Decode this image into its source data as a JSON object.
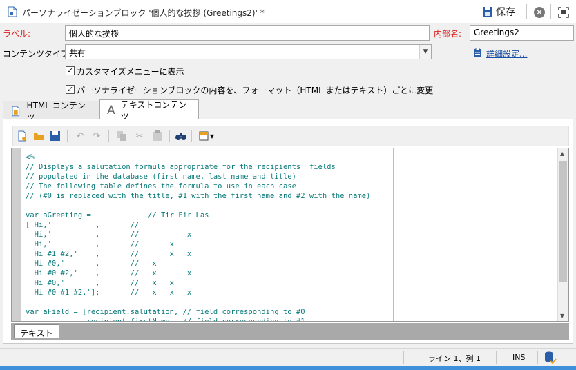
{
  "window": {
    "title": "パーソナライゼーションブロック '個人的な挨拶 (Greetings2)' *",
    "save_label": "保存"
  },
  "form": {
    "label_caption": "ラベル:",
    "label_value": "個人的な挨拶",
    "internal_name_caption": "内部名:",
    "internal_name_value": "Greetings2",
    "content_type_caption": "コンテンツタイプ:",
    "content_type_value": "共有",
    "advanced_settings_link": "詳細設定...",
    "checkbox_customize_menu": "カスタマイズメニューに表示",
    "checkbox_format_change": "パーソナライゼーションブロックの内容を、フォーマット（HTML またはテキスト）ごとに変更"
  },
  "tabs": [
    {
      "label": "HTML コンテンツ",
      "active": false
    },
    {
      "label": "テキストコンテンツ",
      "active": true
    }
  ],
  "tab_icons": {
    "html": "html-doc-icon",
    "text": "A"
  },
  "toolbar_icons": [
    "new-icon",
    "open-folder-icon",
    "save-disk-icon",
    "undo-icon",
    "redo-icon",
    "copy-icon",
    "cut-icon",
    "paste-icon",
    "find-binoculars-icon",
    "insert-menu-icon"
  ],
  "editor": {
    "code": "<%\n// Displays a salutation formula appropriate for the recipients' fields\n// populated in the database (first name, last name and title)\n// The following table defines the formula to use in each case\n// (#0 is replaced with the title, #1 with the first name and #2 with the name)\n\nvar aGreeting =             // Tir Fir Las\n['Hi,'          ,       //\n 'Hi,'          ,       //           x\n 'Hi,'          ,       //       x\n 'Hi #1 #2,'    ,       //       x   x\n 'Hi #0,'       ,       //   x\n 'Hi #0 #2,'    ,       //   x       x\n 'Hi #0,'       ,       //   x   x\n 'Hi #0 #1 #2,'];       //   x   x   x\n\nvar aField = [recipient.salutation, // field corresponding to #0\n              recipient.firstName,  // field corresponding to #1"
  },
  "bottom_tab": "テキスト",
  "status": {
    "position": "ライン 1、列 1",
    "mode": "INS"
  },
  "colors": {
    "code_text": "#0a7a7a",
    "required_label": "#dd2222",
    "link": "#1a4fa3",
    "accent_bar": "#3d90d9"
  }
}
